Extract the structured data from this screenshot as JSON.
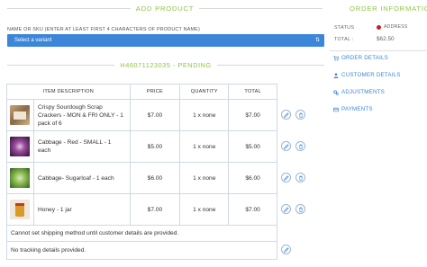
{
  "add_product": {
    "heading": "ADD PRODUCT",
    "sku_label": "NAME OR SKU (ENTER AT LEAST FIRST 4 CHARACTERS OF PRODUCT NAME)",
    "variant_placeholder": "Select a variant"
  },
  "order": {
    "code_heading": "H46071123035 - PENDING"
  },
  "table": {
    "headers": [
      "ITEM DESCRIPTION",
      "PRICE",
      "QUANTITY",
      "TOTAL"
    ],
    "rows": [
      {
        "image_icon": "crackers-thumbnail",
        "description": "Crispy Sourdough Scrap Crackers - MON & FRI ONLY - 1 pack of 6",
        "price": "$7.00",
        "quantity": "1 x none",
        "total": "$7.00"
      },
      {
        "image_icon": "red-cabbage-thumbnail",
        "description": "Cabbage - Red - SMALL - 1 each",
        "price": "$5.00",
        "quantity": "1 x none",
        "total": "$5.00"
      },
      {
        "image_icon": "sugarloaf-cabbage-thumbnail",
        "description": "Cabbage- Sugarloaf - 1 each",
        "price": "$6.00",
        "quantity": "1 x none",
        "total": "$6.00"
      },
      {
        "image_icon": "honey-jar-thumbnail",
        "description": "Honey - 1 jar",
        "price": "$7.00",
        "quantity": "1 x none",
        "total": "$7.00"
      }
    ],
    "shipping_note": "Cannot set shipping method until customer details are provided.",
    "tracking_note": "No tracking details provided."
  },
  "order_info": {
    "heading": "ORDER INFORMATION",
    "status_label": "STATUS",
    "status_value": "ADDRESS",
    "status_color": "#c81e1e",
    "total_label": "TOTAL :",
    "total_value": "$62.50"
  },
  "side_nav": [
    {
      "label": "ORDER DETAILS",
      "icon": "cart-icon"
    },
    {
      "label": "CUSTOMER DETAILS",
      "icon": "user-icon"
    },
    {
      "label": "ADJUSTMENTS",
      "icon": "gears-icon"
    },
    {
      "label": "PAYMENTS",
      "icon": "credit-card-icon"
    }
  ],
  "colors": {
    "accent_green": "#8cc63f",
    "primary_blue": "#3b86d8"
  }
}
